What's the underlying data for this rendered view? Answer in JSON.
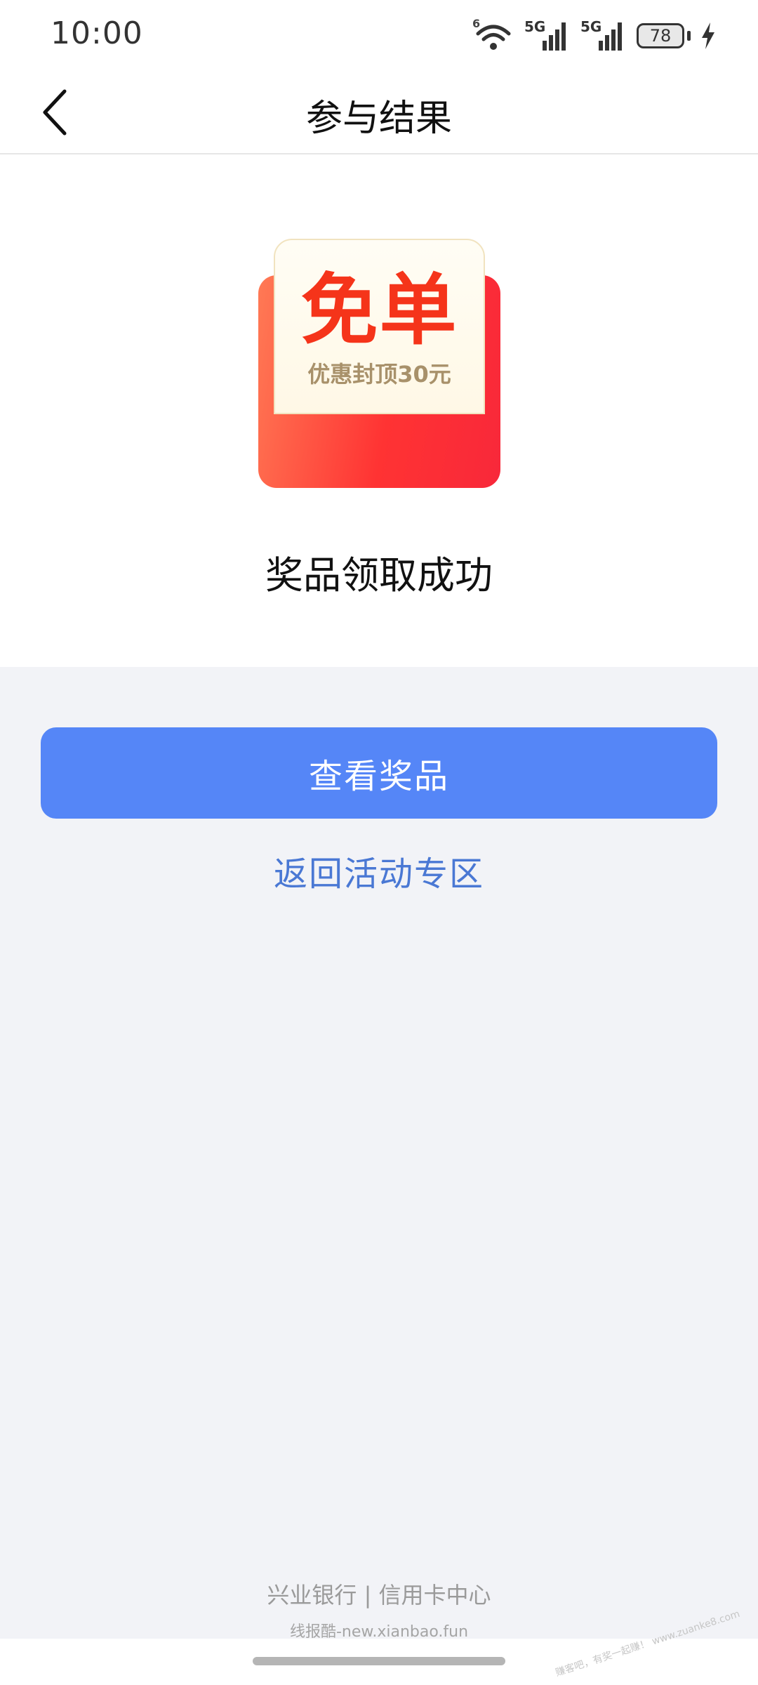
{
  "status_bar": {
    "time": "10:00",
    "wifi_label": "6",
    "sig1_label": "5G",
    "sig2_label": "5G",
    "battery": "78"
  },
  "nav": {
    "title": "参与结果"
  },
  "coupon": {
    "main": "免单",
    "sub": "优惠封顶30元"
  },
  "result_text": "奖品领取成功",
  "primary_button": "查看奖品",
  "link_button": "返回活动专区",
  "footer": "兴业银行 | 信用卡中心",
  "watermark": "线报酷-new.xianbao.fun",
  "corner_watermark": "赚客吧，有奖一起赚！ www.zuanke8.com",
  "colors": {
    "primary": "#5586f7",
    "link": "#4a78d4",
    "coupon_red": "#f5341a"
  }
}
